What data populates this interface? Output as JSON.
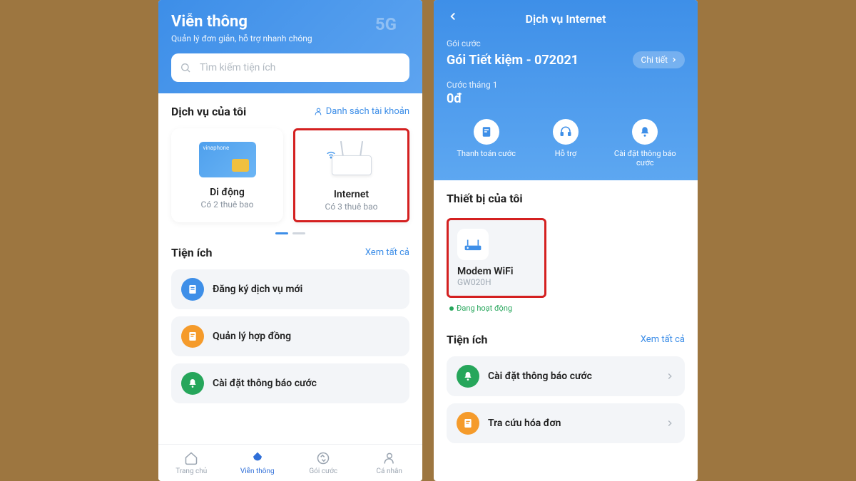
{
  "left": {
    "hero": {
      "title": "Viễn thông",
      "subtitle": "Quản lý đơn giản, hỗ trợ nhanh chóng",
      "tag5g": "5G",
      "search_placeholder": "Tìm kiếm tiện ích"
    },
    "services": {
      "title": "Dịch vụ của tôi",
      "link": "Danh sách tài khoản",
      "items": [
        {
          "title": "Di động",
          "sub": "Có 2 thuê bao"
        },
        {
          "title": "Internet",
          "sub": "Có 3 thuê bao"
        }
      ]
    },
    "utilities": {
      "title": "Tiện ích",
      "link": "Xem tất cả",
      "items": [
        {
          "label": "Đăng ký dịch vụ mới",
          "color": "#3e8fe8"
        },
        {
          "label": "Quản lý hợp đồng",
          "color": "#f59b2b"
        },
        {
          "label": "Cài đặt thông báo cước",
          "color": "#26a65b"
        }
      ]
    },
    "tabs": [
      {
        "label": "Trang chủ"
      },
      {
        "label": "Viễn thông"
      },
      {
        "label": "Gói cước"
      },
      {
        "label": "Cá nhân"
      }
    ]
  },
  "right": {
    "title": "Dịch vụ Internet",
    "pkg_label": "Gói cước",
    "pkg_name": "Gói Tiết kiệm - 072021",
    "chip": "Chi tiết",
    "month_label": "Cước tháng 1",
    "amount": "0đ",
    "actions": [
      {
        "label": "Thanh toán cước"
      },
      {
        "label": "Hỗ trợ"
      },
      {
        "label": "Cài đặt thông báo cước"
      }
    ],
    "devices": {
      "title": "Thiết bị của tôi",
      "item": {
        "name": "Modem WiFi",
        "model": "GW020H",
        "status": "Đang hoạt động"
      }
    },
    "utilities": {
      "title": "Tiện ích",
      "link": "Xem tất cả",
      "items": [
        {
          "label": "Cài đặt thông báo cước",
          "color": "#26a65b"
        },
        {
          "label": "Tra cứu hóa đơn",
          "color": "#f59b2b"
        }
      ]
    }
  }
}
